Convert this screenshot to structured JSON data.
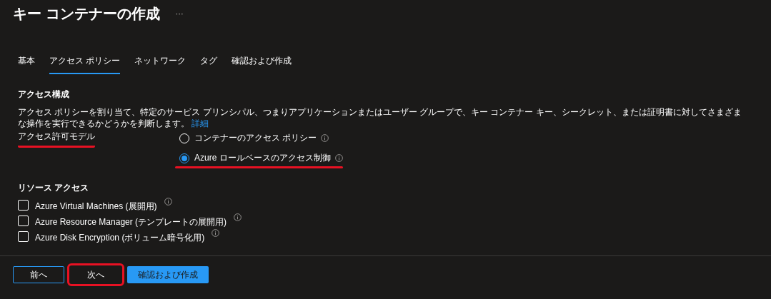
{
  "title": "キー コンテナーの作成",
  "more": "···",
  "tabs": [
    {
      "label": "基本",
      "selected": false
    },
    {
      "label": "アクセス ポリシー",
      "selected": true
    },
    {
      "label": "ネットワーク",
      "selected": false
    },
    {
      "label": "タグ",
      "selected": false
    },
    {
      "label": "確認および作成",
      "selected": false
    }
  ],
  "access_config": {
    "heading": "アクセス構成",
    "description": "アクセス ポリシーを割り当て、特定のサービス プリンシパル、つまりアプリケーションまたはユーザー グループで、キー コンテナー キー、シークレット、または証明書に対してさまざまな操作を実行できるかどうかを判断します。",
    "link": "詳細",
    "permission_label": "アクセス許可モデル",
    "permission_label_highlighted": true,
    "options": [
      {
        "label": "コンテナーのアクセス ポリシー",
        "selected": false,
        "highlighted": false
      },
      {
        "label": "Azure ロールベースのアクセス制御",
        "selected": true,
        "highlighted": true
      }
    ]
  },
  "resource_access": {
    "heading": "リソース アクセス",
    "items": [
      {
        "label": "Azure Virtual Machines (展開用)",
        "checked": false
      },
      {
        "label": "Azure Resource Manager (テンプレートの展開用)",
        "checked": false
      },
      {
        "label": "Azure Disk Encryption (ボリューム暗号化用)",
        "checked": false
      }
    ]
  },
  "buttons": [
    {
      "label": "前へ",
      "kind": "outline",
      "highlighted": false
    },
    {
      "label": "次へ",
      "kind": "plain",
      "highlighted": true
    },
    {
      "label": "確認および作成",
      "kind": "primary",
      "highlighted": false
    }
  ]
}
